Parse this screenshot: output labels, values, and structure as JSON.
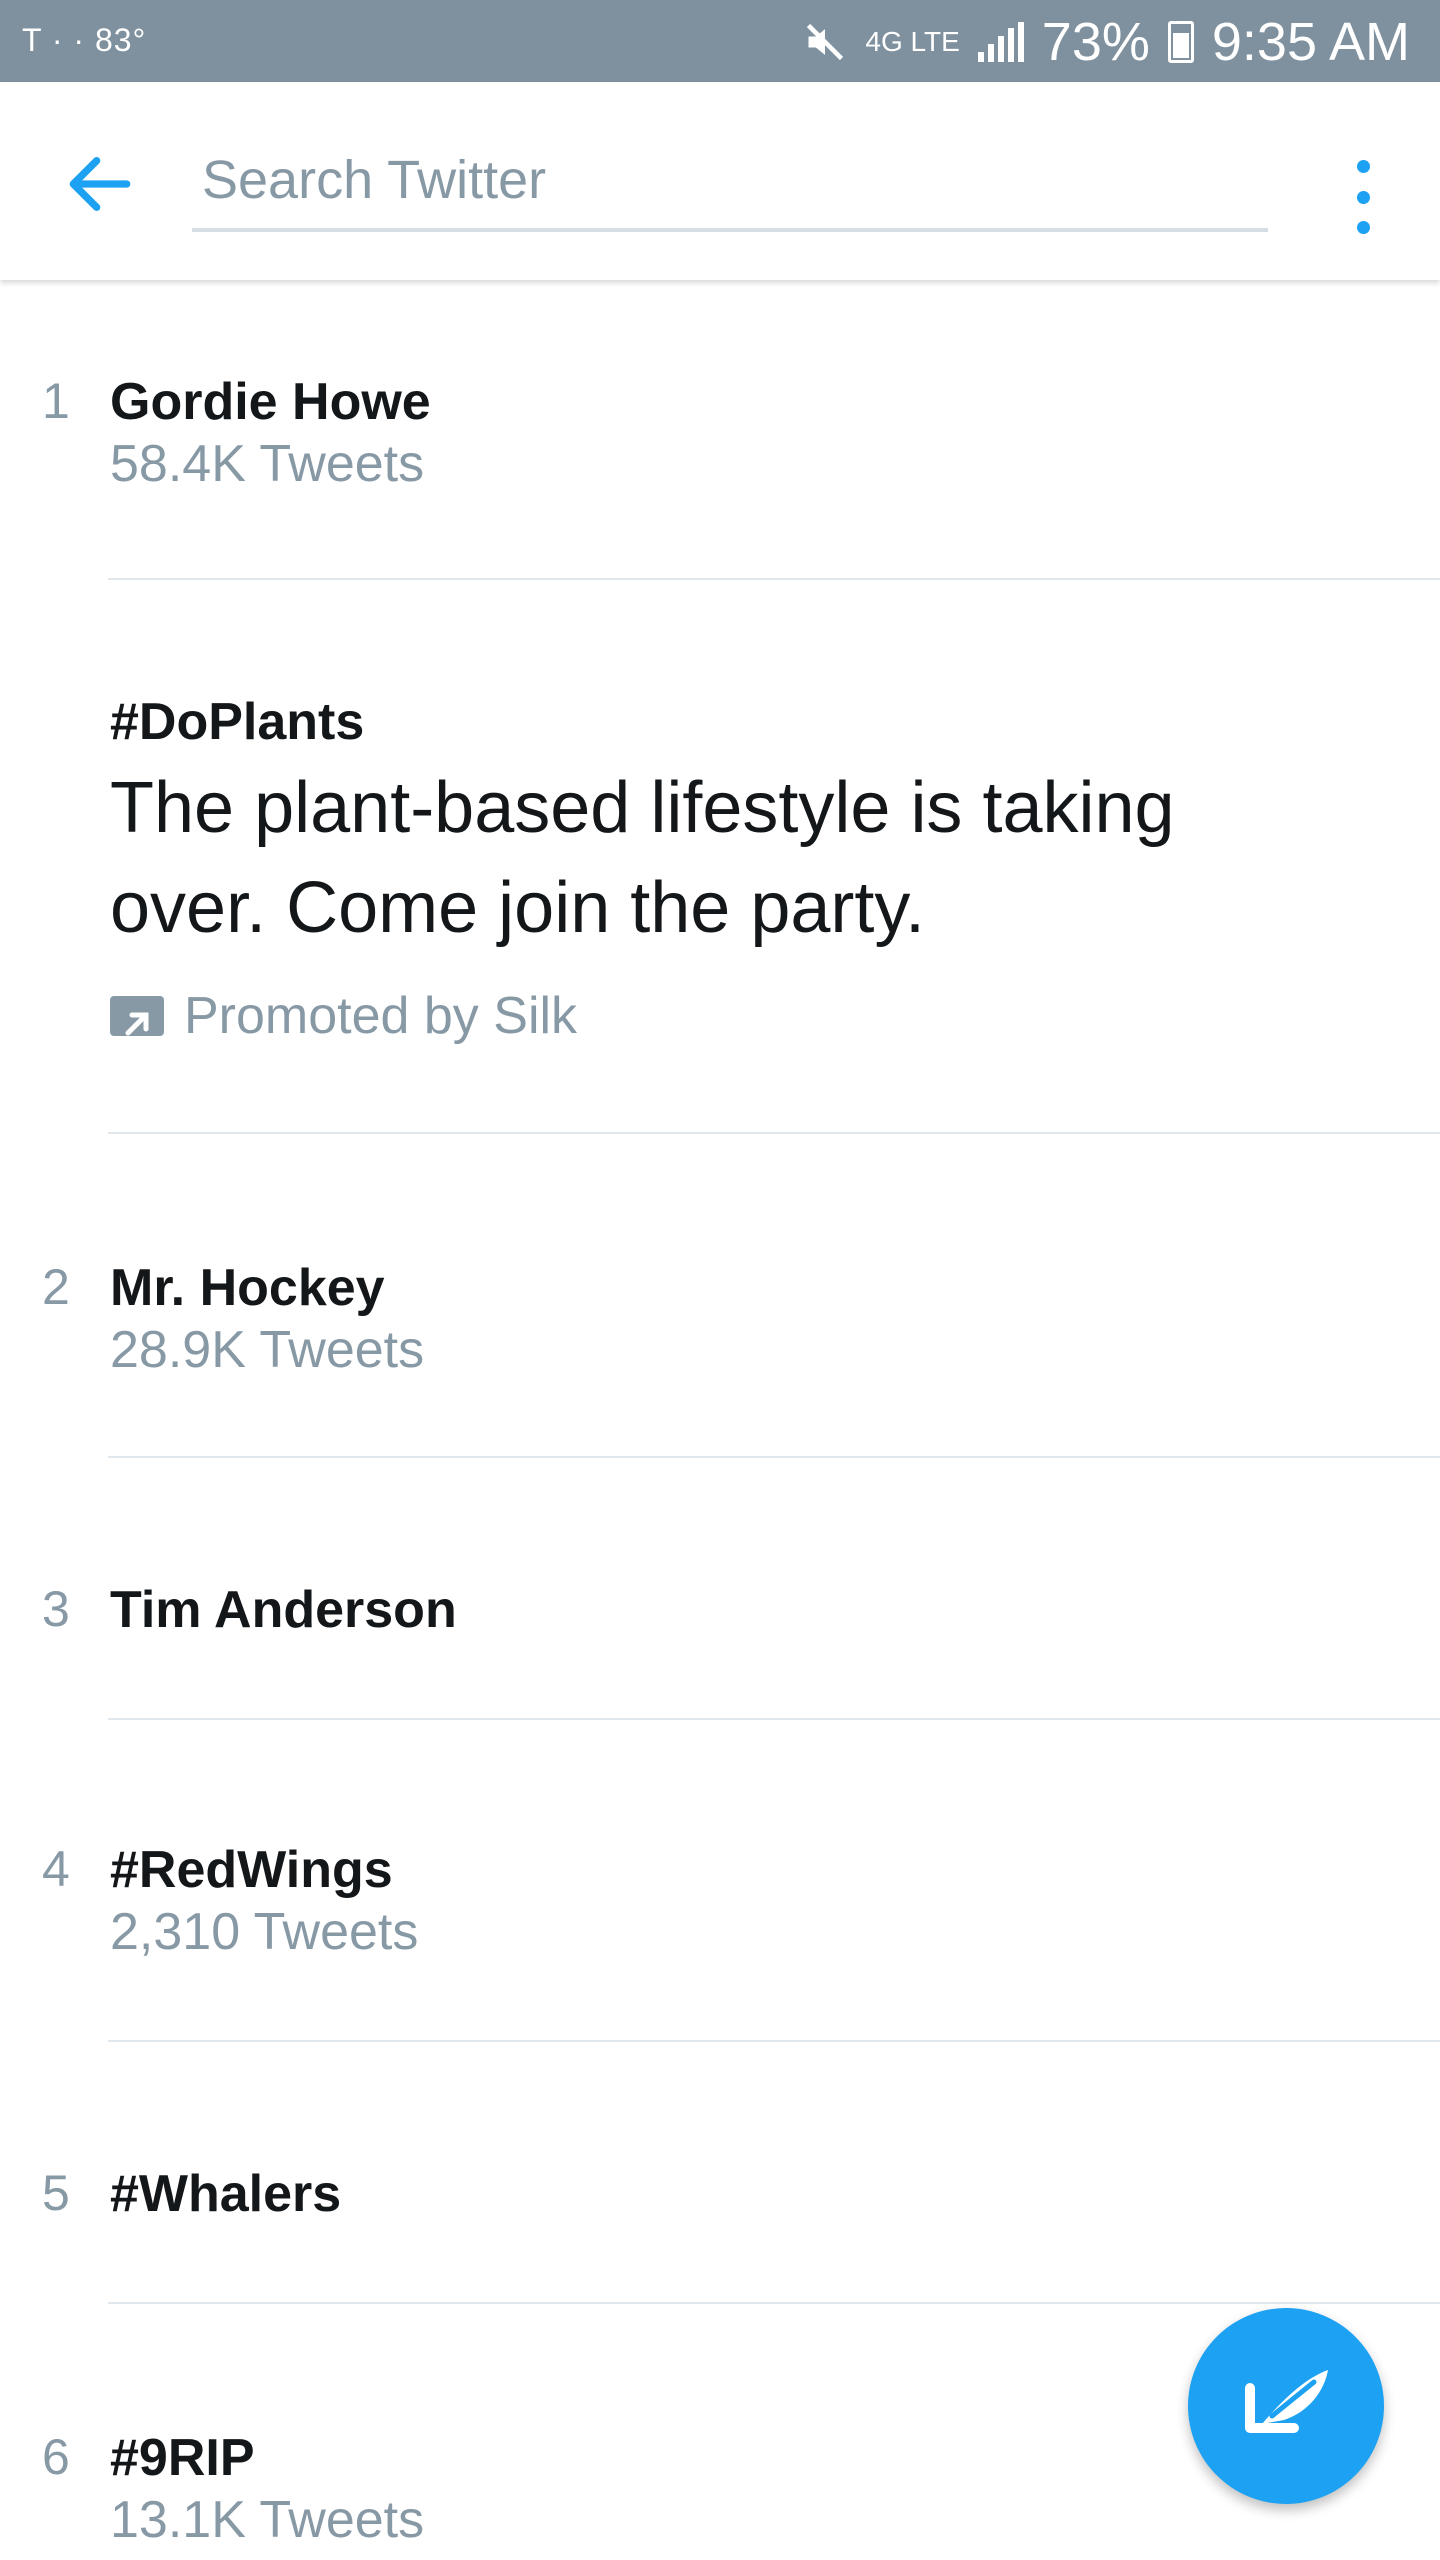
{
  "status_bar": {
    "carrier": "T · · 83°",
    "network_label": "4G LTE",
    "battery": "73%",
    "time": "9:35 AM",
    "icons": [
      "mute-icon",
      "data-icon",
      "signal-icon",
      "battery-icon"
    ]
  },
  "toolbar": {
    "back_icon": "arrow-left-icon",
    "search_placeholder": "Search Twitter",
    "search_value": "",
    "more_icon": "more-vertical-icon",
    "accent_color": "#1da1f2"
  },
  "trends": [
    {
      "rank": "1",
      "name": "Gordie Howe",
      "count": "58.4K Tweets"
    },
    {
      "name": "#DoPlants",
      "description": "The plant-based lifestyle is taking over. Come join the party.",
      "promoted_by": "Promoted by Silk",
      "promoted_icon": "promoted-icon"
    },
    {
      "rank": "2",
      "name": "Mr. Hockey",
      "count": "28.9K Tweets"
    },
    {
      "rank": "3",
      "name": "Tim Anderson"
    },
    {
      "rank": "4",
      "name": "#RedWings",
      "count": "2,310 Tweets"
    },
    {
      "rank": "5",
      "name": "#Whalers"
    },
    {
      "rank": "6",
      "name": "#9RIP",
      "count": "13.1K Tweets"
    }
  ],
  "fab": {
    "icon": "compose-tweet-icon"
  }
}
